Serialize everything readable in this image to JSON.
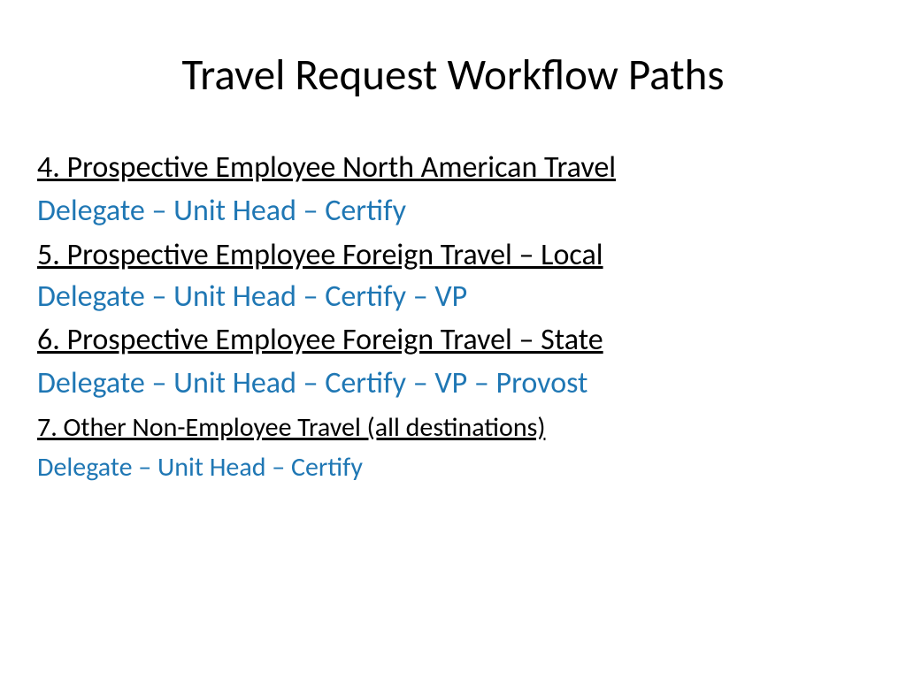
{
  "title": "Travel Request Workflow Paths",
  "colors": {
    "title": "#000000",
    "heading": "#000000",
    "workflow": "#1f77b4"
  },
  "items": [
    {
      "heading": "4. Prospective Employee North American Travel",
      "workflow": "Delegate – Unit Head – Certify"
    },
    {
      "heading": "5. Prospective Employee Foreign Travel – Local",
      "workflow": "Delegate – Unit Head – Certify – VP"
    },
    {
      "heading": "6. Prospective Employee Foreign Travel – State",
      "workflow": "Delegate – Unit Head – Certify – VP – Provost"
    },
    {
      "heading": "7. Other Non-Employee Travel (all destinations)",
      "workflow": "Delegate – Unit Head – Certify"
    }
  ]
}
